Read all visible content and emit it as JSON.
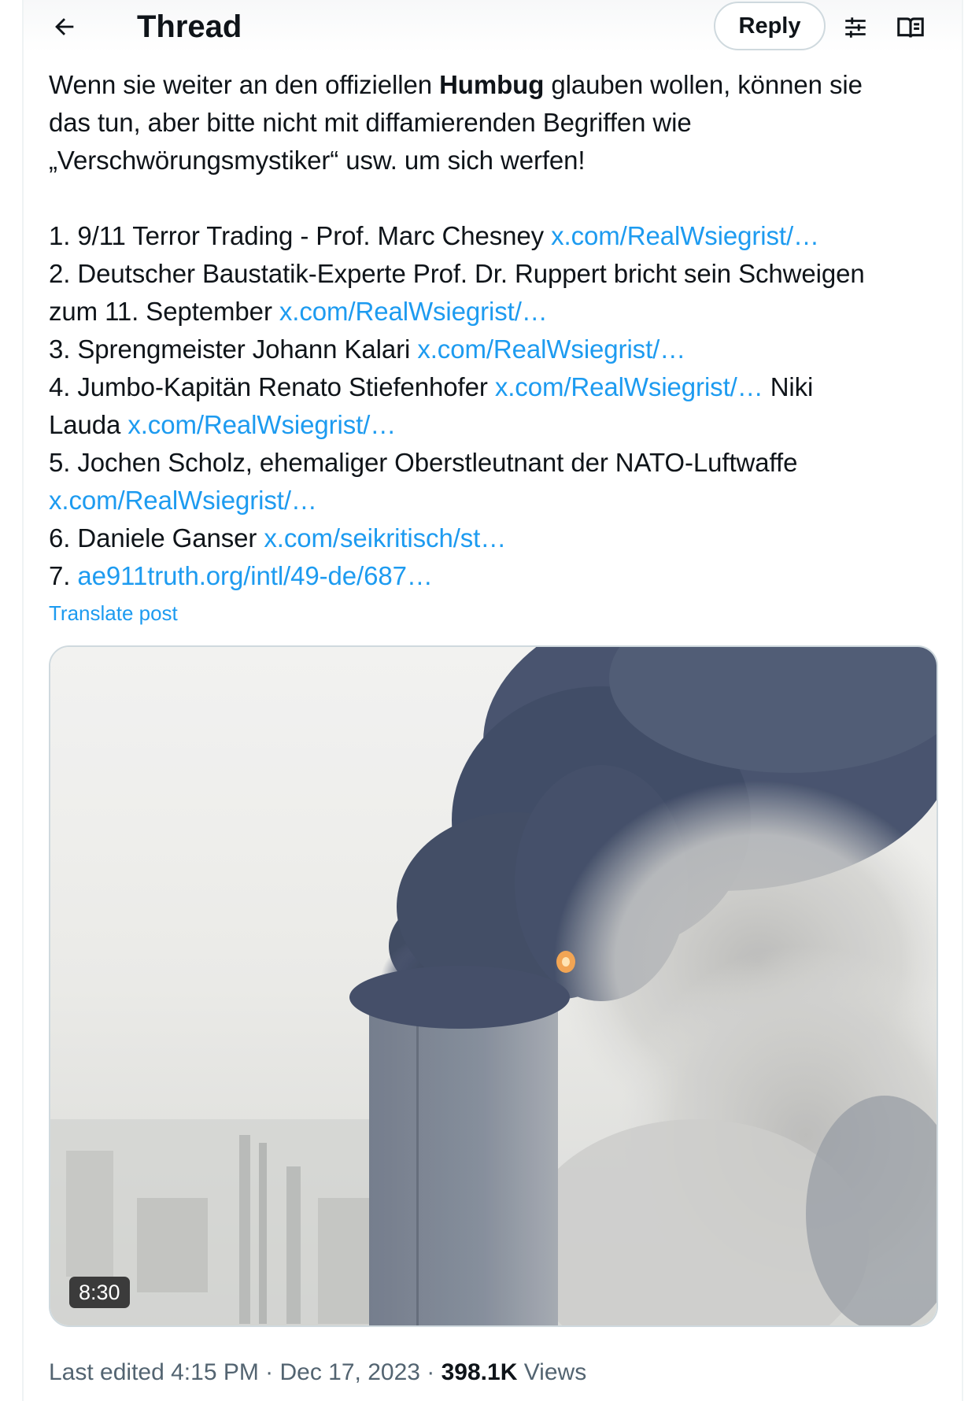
{
  "header": {
    "title": "Thread",
    "reply_label": "Reply",
    "back_icon": "arrow-left-icon",
    "filter_icon": "sliders-icon",
    "reader_icon": "book-open-icon"
  },
  "post": {
    "intro": {
      "p1": "Wenn sie weiter an den offiziellen ",
      "bold": "Humbug",
      "p2": " glauben wollen, können sie",
      "line2": "das tun, aber bitte nicht mit diffamierenden Begriffen wie",
      "line3": "„Verschwörungsmystiker“ usw. um sich werfen!"
    },
    "items": [
      {
        "text": "1. 9/11 Terror Trading - Prof. Marc Chesney  ",
        "link": "x.com/RealWsiegrist/…"
      },
      {
        "text": "2. Deutscher Baustatik-Experte Prof. Dr. Ruppert bricht sein Schweigen",
        "cont": "zum 11. September ",
        "link": "x.com/RealWsiegrist/…"
      },
      {
        "text": "3. Sprengmeister Johann Kalari ",
        "link": "x.com/RealWsiegrist/…"
      },
      {
        "text": "4. Jumbo-Kapitän Renato Stiefenhofer ",
        "link": "x.com/RealWsiegrist/…",
        "after": " Niki",
        "cont": "Lauda ",
        "link2": "x.com/RealWsiegrist/…"
      },
      {
        "text": "5. Jochen Scholz, ehemaliger Oberstleutnant der NATO-Luftwaffe",
        "link": "x.com/RealWsiegrist/…"
      },
      {
        "text": "6. Daniele Ganser ",
        "link": "x.com/seikritisch/st…"
      },
      {
        "text": "7. ",
        "link": "ae911truth.org/intl/49-de/687…"
      }
    ],
    "translate_label": "Translate post"
  },
  "video": {
    "duration": "8:30"
  },
  "meta": {
    "edited": "Last edited 4:15 PM · Dec 17, 2023 · ",
    "views_count": "398.1K",
    "views_label": " Views"
  }
}
